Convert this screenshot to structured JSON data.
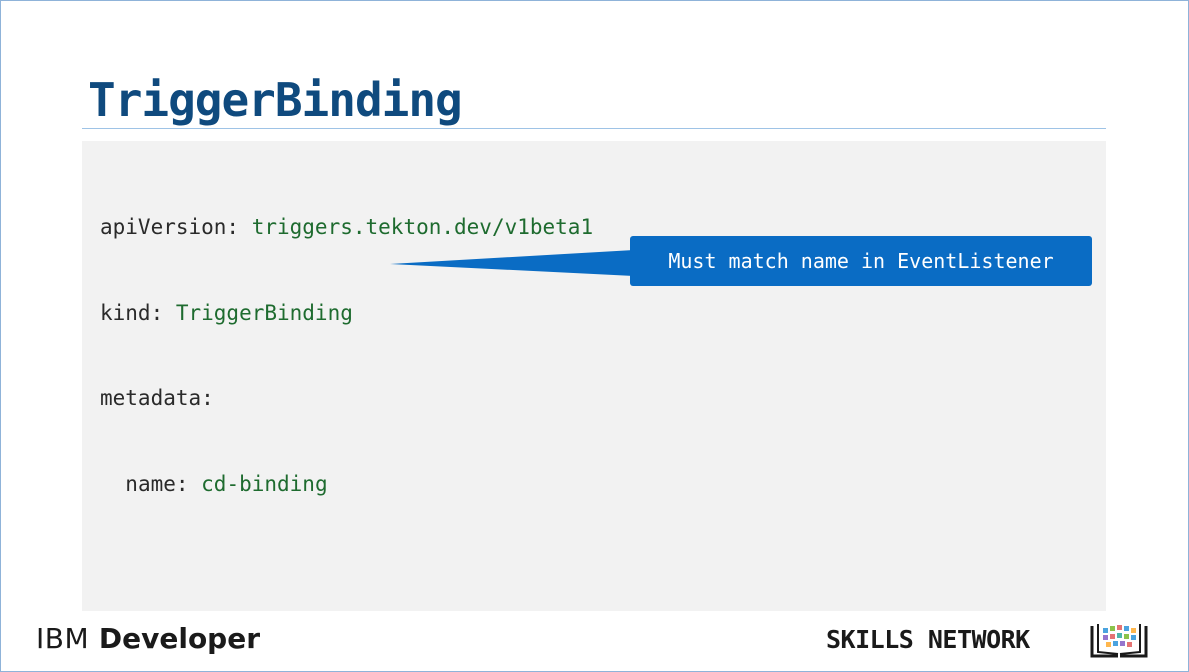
{
  "slide": {
    "title": "TriggerBinding"
  },
  "code": {
    "lines": [
      {
        "indent": "",
        "key": "apiVersion:",
        "value": " triggers.tekton.dev/v1beta1"
      },
      {
        "indent": "",
        "key": "kind:",
        "value": " TriggerBinding"
      },
      {
        "indent": "",
        "key": "metadata:",
        "value": ""
      },
      {
        "indent": "  ",
        "key": "name:",
        "value": " cd-binding"
      }
    ]
  },
  "callout": {
    "text": "Must match name in EventListener",
    "color": "#0a6cc4"
  },
  "footer": {
    "left_brand_ibm": "IBM",
    "left_brand_developer": " Developer",
    "right_brand": "SKILLS NETWORK",
    "logo_icon": "skills-network-book-icon"
  },
  "colors": {
    "title": "#0f4a7e",
    "code_value": "#1e6b2f",
    "code_background": "#f2f2f2"
  }
}
